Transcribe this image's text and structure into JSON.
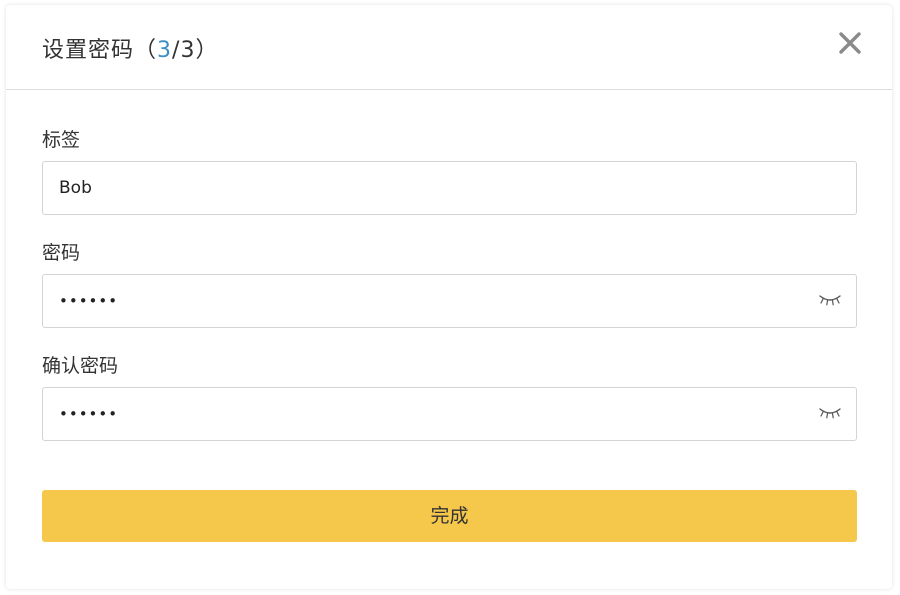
{
  "dialog": {
    "title": "设置密码",
    "step_open": "（",
    "step_current": "3",
    "step_sep": "/",
    "step_total": "3",
    "step_close": "）",
    "close_icon": "close-icon"
  },
  "form": {
    "label_field": {
      "label": "标签",
      "value": "Bob"
    },
    "password_field": {
      "label": "密码",
      "value": "••••••",
      "toggle_icon": "eye-closed-icon"
    },
    "confirm_field": {
      "label": "确认密码",
      "value": "••••••",
      "toggle_icon": "eye-closed-icon"
    }
  },
  "submit": {
    "label": "完成"
  },
  "colors": {
    "accent_yellow": "#f5c84c",
    "step_blue": "#3b8fc4",
    "text": "#333333",
    "border": "#d4d4d4"
  }
}
